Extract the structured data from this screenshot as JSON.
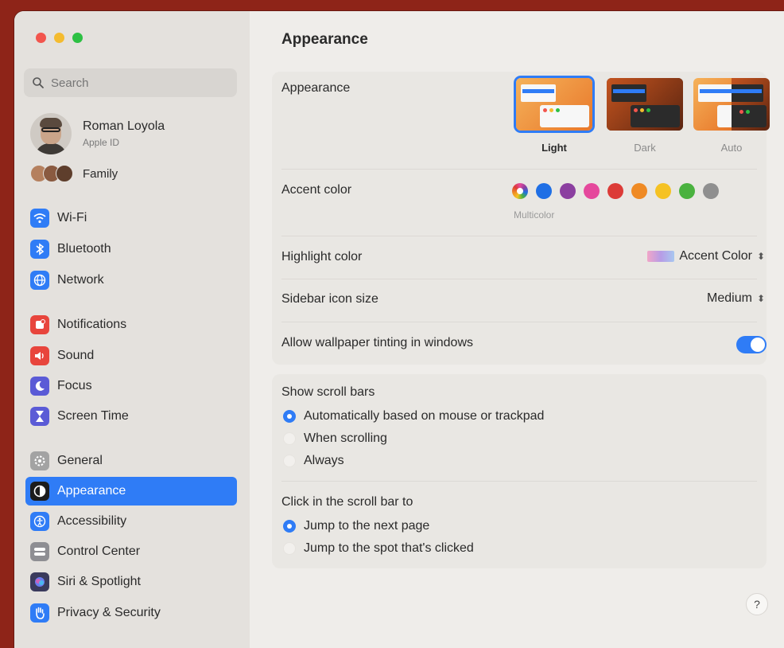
{
  "window": {
    "traffic_lights": [
      "close",
      "minimize",
      "zoom"
    ]
  },
  "sidebar": {
    "search_placeholder": "Search",
    "profile": {
      "name": "Roman Loyola",
      "subtitle": "Apple ID"
    },
    "family_label": "Family",
    "items": [
      {
        "label": "Wi-Fi",
        "icon": "wifi-icon",
        "color": "#2f7cf6"
      },
      {
        "label": "Bluetooth",
        "icon": "bluetooth-icon",
        "color": "#2f7cf6"
      },
      {
        "label": "Network",
        "icon": "globe-icon",
        "color": "#2f7cf6"
      },
      {
        "label": "Notifications",
        "icon": "bell-icon",
        "color": "#e8453c"
      },
      {
        "label": "Sound",
        "icon": "speaker-icon",
        "color": "#e8453c"
      },
      {
        "label": "Focus",
        "icon": "moon-icon",
        "color": "#5b5bd6"
      },
      {
        "label": "Screen Time",
        "icon": "hourglass-icon",
        "color": "#5b5bd6"
      },
      {
        "label": "General",
        "icon": "gear-icon",
        "color": "#9a9a9a"
      },
      {
        "label": "Appearance",
        "icon": "appearance-icon",
        "color": "#1c1c1c",
        "selected": true
      },
      {
        "label": "Accessibility",
        "icon": "accessibility-icon",
        "color": "#2f7cf6"
      },
      {
        "label": "Control Center",
        "icon": "control-center-icon",
        "color": "#8e8e93"
      },
      {
        "label": "Siri & Spotlight",
        "icon": "siri-icon",
        "color": "#3a3a5c"
      },
      {
        "label": "Privacy & Security",
        "icon": "hand-icon",
        "color": "#2f7cf6"
      }
    ]
  },
  "main": {
    "title": "Appearance",
    "appearance": {
      "label": "Appearance",
      "options": [
        {
          "name": "Light",
          "selected": true
        },
        {
          "name": "Dark",
          "selected": false
        },
        {
          "name": "Auto",
          "selected": false
        }
      ]
    },
    "accent": {
      "label": "Accent color",
      "selected_name": "Multicolor",
      "colors": [
        "multicolor",
        "#1f6fe5",
        "#8b3fa0",
        "#e5489c",
        "#dc3b37",
        "#ef8a24",
        "#f5c223",
        "#4ab23f",
        "#8f8f8f"
      ]
    },
    "highlight": {
      "label": "Highlight color",
      "value": "Accent Color"
    },
    "sidebar_icon_size": {
      "label": "Sidebar icon size",
      "value": "Medium"
    },
    "wallpaper_tinting": {
      "label": "Allow wallpaper tinting in windows",
      "enabled": true
    },
    "scroll_bars": {
      "label": "Show scroll bars",
      "options": [
        "Automatically based on mouse or trackpad",
        "When scrolling",
        "Always"
      ],
      "selected": 0
    },
    "click_scroll": {
      "label": "Click in the scroll bar to",
      "options": [
        "Jump to the next page",
        "Jump to the spot that's clicked"
      ],
      "selected": 0
    },
    "help_label": "?"
  }
}
